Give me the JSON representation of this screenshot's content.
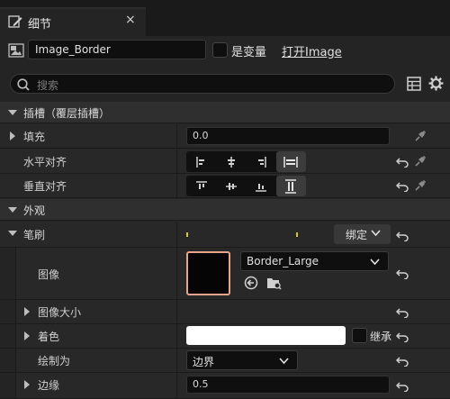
{
  "tab": {
    "title": "细节",
    "close": "×"
  },
  "widget": {
    "name": "Image_Border",
    "is_variable_label": "是变量",
    "open_link": "打开Image"
  },
  "search": {
    "placeholder": "搜索"
  },
  "sections": {
    "slot": "插槽（覆层插槽）",
    "appearance": "外观"
  },
  "slot_rows": {
    "padding_label": "填充",
    "padding_value": "0.0",
    "halign_label": "水平对齐",
    "valign_label": "垂直对齐"
  },
  "brush": {
    "label": "笔刷",
    "bind_label": "绑定",
    "image_label": "图像",
    "image_asset": "Border_Large",
    "image_size_label": "图像大小",
    "tint_label": "着色",
    "tint_color": "#ffffff",
    "inherit_label": "继承",
    "draw_as_label": "绘制为",
    "draw_as_value": "边界",
    "margin_label": "边缘",
    "margin_value": "0.5"
  },
  "colors": {
    "accent_outline": "#e6a48a",
    "tick": "#d6c43a"
  }
}
